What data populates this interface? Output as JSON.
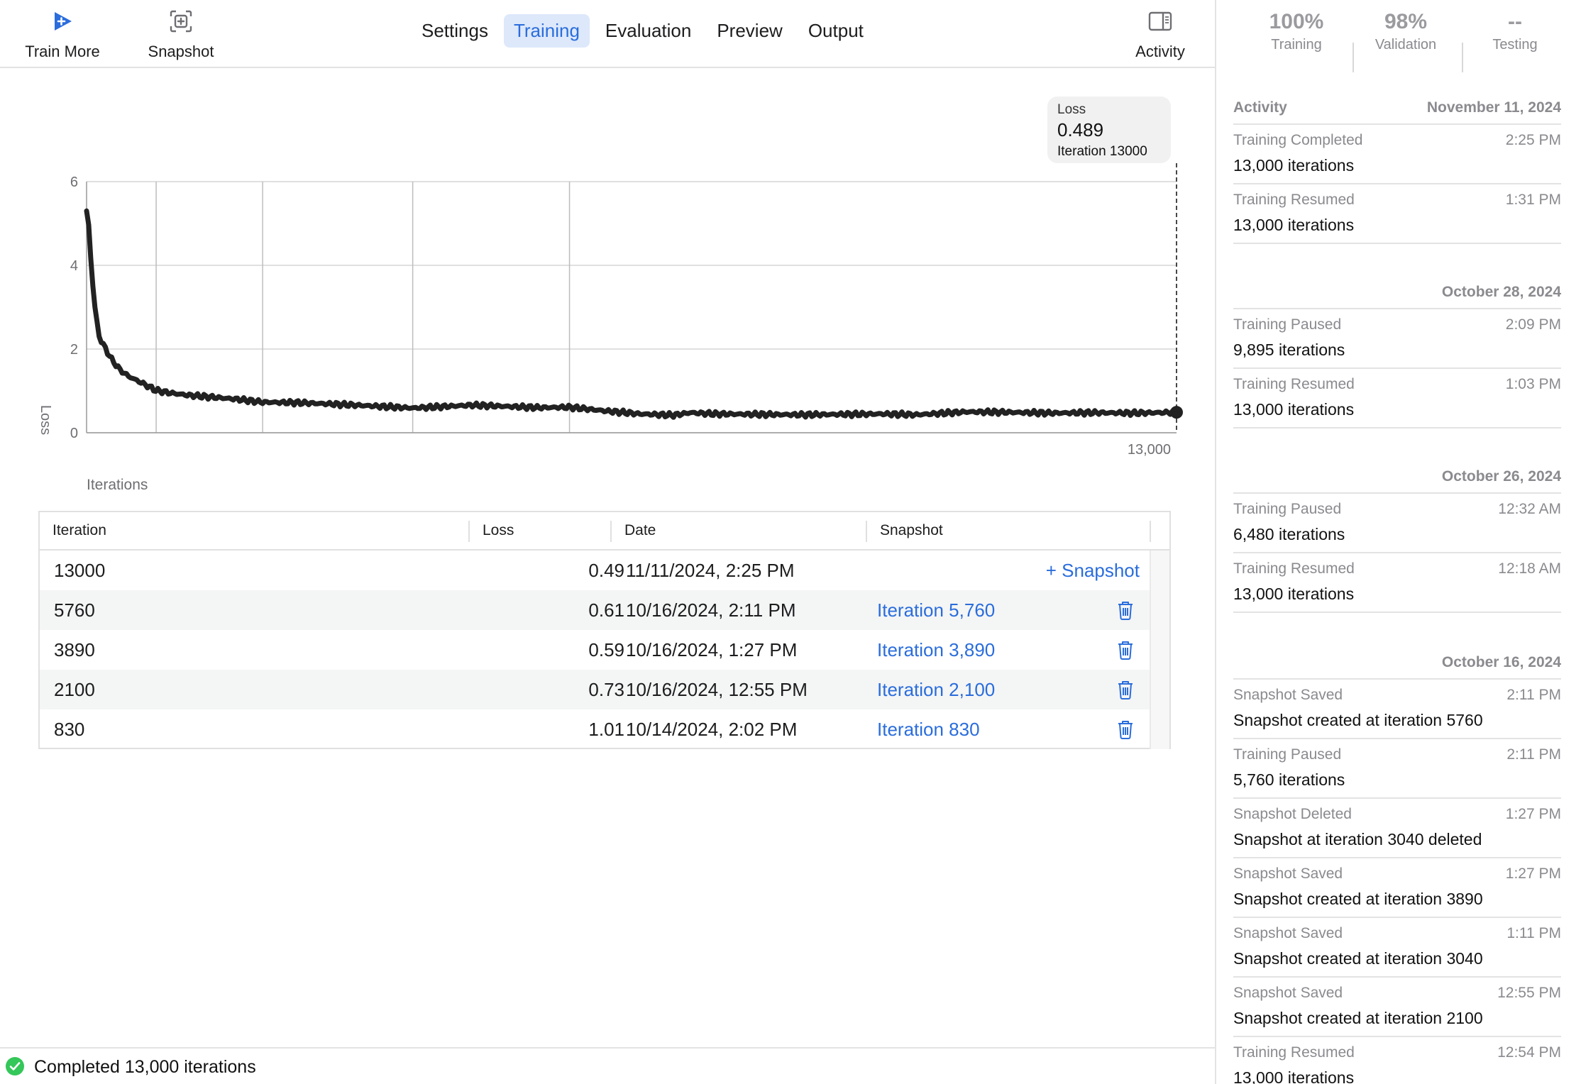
{
  "toolbar": {
    "train_more_label": "Train More",
    "snapshot_label": "Snapshot",
    "activity_label": "Activity",
    "accent_color": "#2a6ddc"
  },
  "tabs": [
    {
      "label": "Settings",
      "active": false
    },
    {
      "label": "Training",
      "active": true
    },
    {
      "label": "Evaluation",
      "active": false
    },
    {
      "label": "Preview",
      "active": false
    },
    {
      "label": "Output",
      "active": false
    }
  ],
  "stats": [
    {
      "value": "100%",
      "label": "Training"
    },
    {
      "value": "98%",
      "label": "Validation"
    },
    {
      "value": "--",
      "label": "Testing"
    }
  ],
  "activity": {
    "title": "Activity",
    "groups": [
      {
        "date": "November 11, 2024",
        "items": [
          {
            "event": "Training Completed",
            "time": "2:25 PM",
            "detail": "13,000 iterations"
          },
          {
            "event": "Training Resumed",
            "time": "1:31 PM",
            "detail": "13,000 iterations"
          }
        ]
      },
      {
        "date": "October 28, 2024",
        "items": [
          {
            "event": "Training Paused",
            "time": "2:09 PM",
            "detail": "9,895 iterations"
          },
          {
            "event": "Training Resumed",
            "time": "1:03 PM",
            "detail": "13,000 iterations"
          }
        ]
      },
      {
        "date": "October 26, 2024",
        "items": [
          {
            "event": "Training Paused",
            "time": "12:32 AM",
            "detail": "6,480 iterations"
          },
          {
            "event": "Training Resumed",
            "time": "12:18 AM",
            "detail": "13,000 iterations"
          }
        ]
      },
      {
        "date": "October 16, 2024",
        "items": [
          {
            "event": "Snapshot Saved",
            "time": "2:11 PM",
            "detail": "Snapshot created at iteration 5760"
          },
          {
            "event": "Training Paused",
            "time": "2:11 PM",
            "detail": "5,760 iterations"
          },
          {
            "event": "Snapshot Deleted",
            "time": "1:27 PM",
            "detail": "Snapshot at iteration 3040 deleted"
          },
          {
            "event": "Snapshot Saved",
            "time": "1:27 PM",
            "detail": "Snapshot created at iteration 3890"
          },
          {
            "event": "Snapshot Saved",
            "time": "1:11 PM",
            "detail": "Snapshot created at iteration 3040"
          },
          {
            "event": "Snapshot Saved",
            "time": "12:55 PM",
            "detail": "Snapshot created at iteration 2100"
          },
          {
            "event": "Training Resumed",
            "time": "12:54 PM",
            "detail": "13,000 iterations"
          }
        ]
      }
    ]
  },
  "tooltip": {
    "label": "Loss",
    "value": "0.489",
    "iteration": "Iteration 13000"
  },
  "chart_data": {
    "type": "line",
    "title": "",
    "xlabel": "Iterations",
    "ylabel": "Loss",
    "xlim": [
      0,
      13000
    ],
    "ylim": [
      0,
      6
    ],
    "y_ticks": [
      "0",
      "2",
      "4",
      "6"
    ],
    "x_ticks": [
      "13,000"
    ],
    "grid": true,
    "snapshot_markers": [
      830,
      2100,
      3890,
      5760
    ],
    "line_color": "#222222",
    "series": [
      {
        "x": [
          0,
          30,
          60,
          100,
          150,
          200,
          300,
          400,
          500,
          650,
          830,
          1000,
          1200,
          1500,
          1800,
          2100,
          2500,
          3000,
          3500,
          3890,
          4200,
          4600,
          5000,
          5400,
          5760,
          6200,
          6600,
          7000,
          7200,
          7500,
          8000,
          8500,
          9000,
          9500,
          9895,
          10500,
          11000,
          11500,
          12000,
          12500,
          13000
        ],
        "y": [
          5.3,
          4.9,
          3.8,
          3.0,
          2.3,
          2.1,
          1.75,
          1.5,
          1.35,
          1.2,
          1.01,
          0.95,
          0.9,
          0.85,
          0.8,
          0.73,
          0.72,
          0.68,
          0.63,
          0.59,
          0.62,
          0.66,
          0.63,
          0.6,
          0.61,
          0.52,
          0.45,
          0.42,
          0.48,
          0.45,
          0.44,
          0.43,
          0.44,
          0.45,
          0.43,
          0.5,
          0.49,
          0.47,
          0.48,
          0.47,
          0.489
        ]
      }
    ]
  },
  "table": {
    "columns": [
      "Iteration",
      "Loss",
      "Date",
      "Snapshot"
    ],
    "rows": [
      {
        "iteration": "13000",
        "loss": "0.49",
        "date": "11/11/2024, 2:25 PM",
        "snapshot": "",
        "action": "+ Snapshot"
      },
      {
        "iteration": "5760",
        "loss": "0.61",
        "date": "10/16/2024, 2:11 PM",
        "snapshot": "Iteration 5,760",
        "action": ""
      },
      {
        "iteration": "3890",
        "loss": "0.59",
        "date": "10/16/2024, 1:27 PM",
        "snapshot": "Iteration 3,890",
        "action": ""
      },
      {
        "iteration": "2100",
        "loss": "0.73",
        "date": "10/16/2024, 12:55 PM",
        "snapshot": "Iteration 2,100",
        "action": ""
      },
      {
        "iteration": "830",
        "loss": "1.01",
        "date": "10/14/2024, 2:02 PM",
        "snapshot": "Iteration 830",
        "action": ""
      }
    ]
  },
  "status": {
    "text": "Completed 13,000 iterations",
    "color": "#34c759"
  }
}
